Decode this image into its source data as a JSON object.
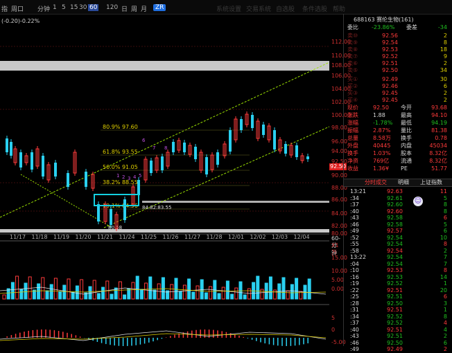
{
  "toolbar": {
    "index_label": "指",
    "period_label": "周口",
    "minute_label": "分钟",
    "periods": [
      "1",
      "5",
      "15",
      "30",
      "60",
      "120",
      "日",
      "周",
      "月"
    ],
    "active_period": "60",
    "badge": "ZR",
    "ghost_items": [
      "系统设置",
      "交易系统",
      "自选股",
      "条件选股",
      "帮助"
    ]
  },
  "main_chart": {
    "change_readout": "(-0.20)-0.22%",
    "y_axis_labels": [
      "112.00",
      "110.00",
      "108.00",
      "106.00",
      "104.00",
      "102.00",
      "100.00",
      "98.00",
      "96.00",
      "94.00",
      "92.50",
      "90.00",
      "88.00",
      "86.00",
      "84.00",
      "82.00",
      "80.00"
    ],
    "current_price_tag": "92.50",
    "x_axis_labels": [
      "11/17",
      "11/18",
      "11/19",
      "11/20",
      "11/21",
      "11/24",
      "11/25",
      "11/26",
      "11/27",
      "11/28",
      "12/01",
      "12/02",
      "12/03",
      "12/04"
    ],
    "fib_labels": [
      "80.9% 97.60",
      "61.8% 93.55",
      "50.0% 91.05",
      "38.2% 88.55",
      "19.1% 84.56"
    ],
    "price_note": "84.82:83.55",
    "low_label": "80.58",
    "wave_labels": [
      "1",
      "2",
      "3",
      "4",
      "5",
      "6",
      "7",
      "8"
    ],
    "volume_pane": {
      "header": "60-分钟",
      "sub_header": "X1万",
      "y_axis_labels": [
        "15.00",
        "10.00",
        "5.00",
        "0.00"
      ]
    },
    "macd_pane": {
      "y_axis_labels": [
        "5",
        "0",
        "-5.00"
      ]
    }
  },
  "quote_panel": {
    "title": "688163 赛伦生物(161)",
    "ratio_label": "委比",
    "ratio_value": "-23.86%",
    "ratio_diff_label": "委差",
    "ratio_diff_value": "-34",
    "asks": [
      {
        "label": "卖⑩",
        "price": "92.56",
        "vol": "2"
      },
      {
        "label": "卖⑨",
        "price": "92.54",
        "vol": "8"
      },
      {
        "label": "卖⑧",
        "price": "92.53",
        "vol": "18"
      },
      {
        "label": "卖⑦",
        "price": "92.52",
        "vol": "9"
      },
      {
        "label": "卖⑥",
        "price": "92.51",
        "vol": "2"
      },
      {
        "label": "卖⑤",
        "price": "92.50",
        "vol": "34"
      }
    ],
    "bids": [
      {
        "label": "买①",
        "price": "92.49",
        "vol": "30"
      },
      {
        "label": "买②",
        "price": "92.46",
        "vol": "6"
      },
      {
        "label": "买③",
        "price": "92.45",
        "vol": "2"
      },
      {
        "label": "买④",
        "price": "92.45",
        "vol": "2"
      }
    ],
    "stats": [
      {
        "l1": "现价",
        "v1": "92.50",
        "l2": "今开",
        "v2": "93.68"
      },
      {
        "l1": "涨跌",
        "v1": "1.88",
        "l2": "最高",
        "v2": "94.10"
      },
      {
        "l1": "涨幅",
        "v1": "-1.78%",
        "l2": "最低",
        "v2": "94.19"
      },
      {
        "l1": "振幅",
        "v1": "2.87%",
        "l2": "量比",
        "v2": "81.38"
      },
      {
        "l1": "总量",
        "v1": "8.58万",
        "l2": "换手",
        "v2": "0.78"
      },
      {
        "l1": "外盘",
        "v1": "40445",
        "l2": "内盘",
        "v2": "45034"
      },
      {
        "l1": "换手",
        "v1": "1.03%",
        "l2": "股本",
        "v2": "8.32亿"
      },
      {
        "l1": "净资",
        "v1": "769亿",
        "l2": "流通",
        "v2": "8.32亿"
      },
      {
        "l1": "收益",
        "v1": "1.36¥",
        "l2": "PE",
        "v2": "51.77"
      }
    ],
    "tabs": [
      "分时成交",
      "明细",
      "上证指数"
    ],
    "trades": [
      {
        "t": "13:21",
        "p": "92.63",
        "v": "11"
      },
      {
        "t": ":34",
        "p": "92.61",
        "v": "5"
      },
      {
        "t": ":37",
        "p": "92.60",
        "v": "8"
      },
      {
        "t": ":40",
        "p": "92.60",
        "v": "8"
      },
      {
        "t": ":43",
        "p": "92.58",
        "v": "6"
      },
      {
        "t": ":46",
        "p": "92.58",
        "v": "5"
      },
      {
        "t": ":49",
        "p": "92.57",
        "v": "6"
      },
      {
        "t": ":52",
        "p": "92.54",
        "v": "10"
      },
      {
        "t": ":55",
        "p": "92.54",
        "v": "8"
      },
      {
        "t": ":58",
        "p": "92.54",
        "v": "2"
      },
      {
        "t": "13:22",
        "p": "92.54",
        "v": "7"
      },
      {
        "t": ":04",
        "p": "92.54",
        "v": "7"
      },
      {
        "t": ":10",
        "p": "92.53",
        "v": "8"
      },
      {
        "t": ":16",
        "p": "92.53",
        "v": "14"
      },
      {
        "t": ":19",
        "p": "92.52",
        "v": "1"
      },
      {
        "t": ":22",
        "p": "92.51",
        "v": "20"
      },
      {
        "t": ":25",
        "p": "92.51",
        "v": "6"
      },
      {
        "t": ":28",
        "p": "92.50",
        "v": "3"
      },
      {
        "t": ":31",
        "p": "92.51",
        "v": "1"
      },
      {
        "t": ":34",
        "p": "92.52",
        "v": "8"
      },
      {
        "t": ":37",
        "p": "92.52",
        "v": "4"
      },
      {
        "t": ":40",
        "p": "92.51",
        "v": "4"
      },
      {
        "t": ":43",
        "p": "92.51",
        "v": "2"
      },
      {
        "t": ":46",
        "p": "92.50",
        "v": "6"
      },
      {
        "t": ":49",
        "p": "92.49",
        "v": "2"
      }
    ]
  },
  "colors": {
    "up": "#ff3b3b",
    "down": "#2ad0f0",
    "channel": "#9be000",
    "fib_box": "#14d0e0",
    "panel_bg": "#000000"
  }
}
